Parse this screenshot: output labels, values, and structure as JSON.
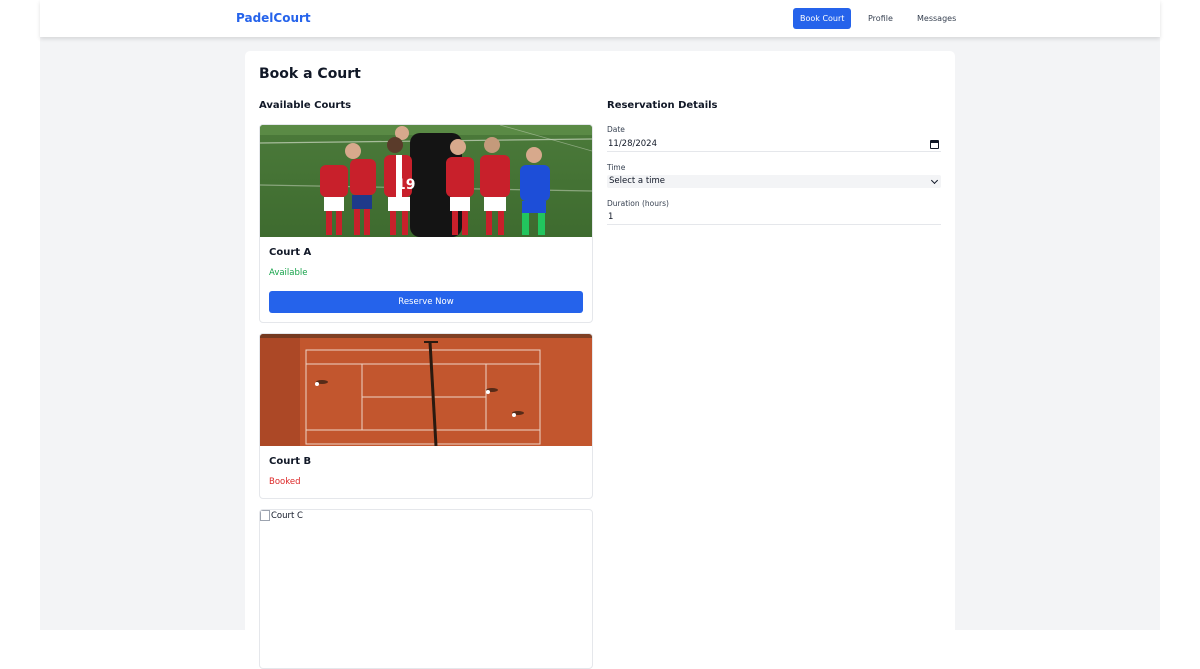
{
  "nav": {
    "brand": "PadelCourt",
    "links": [
      {
        "label": "Book Court",
        "active": true
      },
      {
        "label": "Profile",
        "active": false
      },
      {
        "label": "Messages",
        "active": false
      }
    ]
  },
  "page": {
    "title": "Book a Court"
  },
  "courts_section": {
    "title": "Available Courts",
    "courts": [
      {
        "name": "Court A",
        "status": "Available",
        "status_color": "#16a34a",
        "action": "Reserve Now",
        "image": "soccer-kids-photo"
      },
      {
        "name": "Court B",
        "status": "Booked",
        "status_color": "#dc2626",
        "image": "clay-tennis-court-photo"
      },
      {
        "name": "Court C",
        "image_alt": "Court C",
        "image": "broken-image"
      }
    ]
  },
  "reservation": {
    "title": "Reservation Details",
    "date_label": "Date",
    "date_value": "11/28/2024",
    "time_label": "Time",
    "time_value": "Select a time",
    "duration_label": "Duration (hours)",
    "duration_value": "1"
  },
  "colors": {
    "accent": "#2563eb",
    "page_bg": "#f3f4f6",
    "available": "#16a34a",
    "booked": "#dc2626"
  }
}
